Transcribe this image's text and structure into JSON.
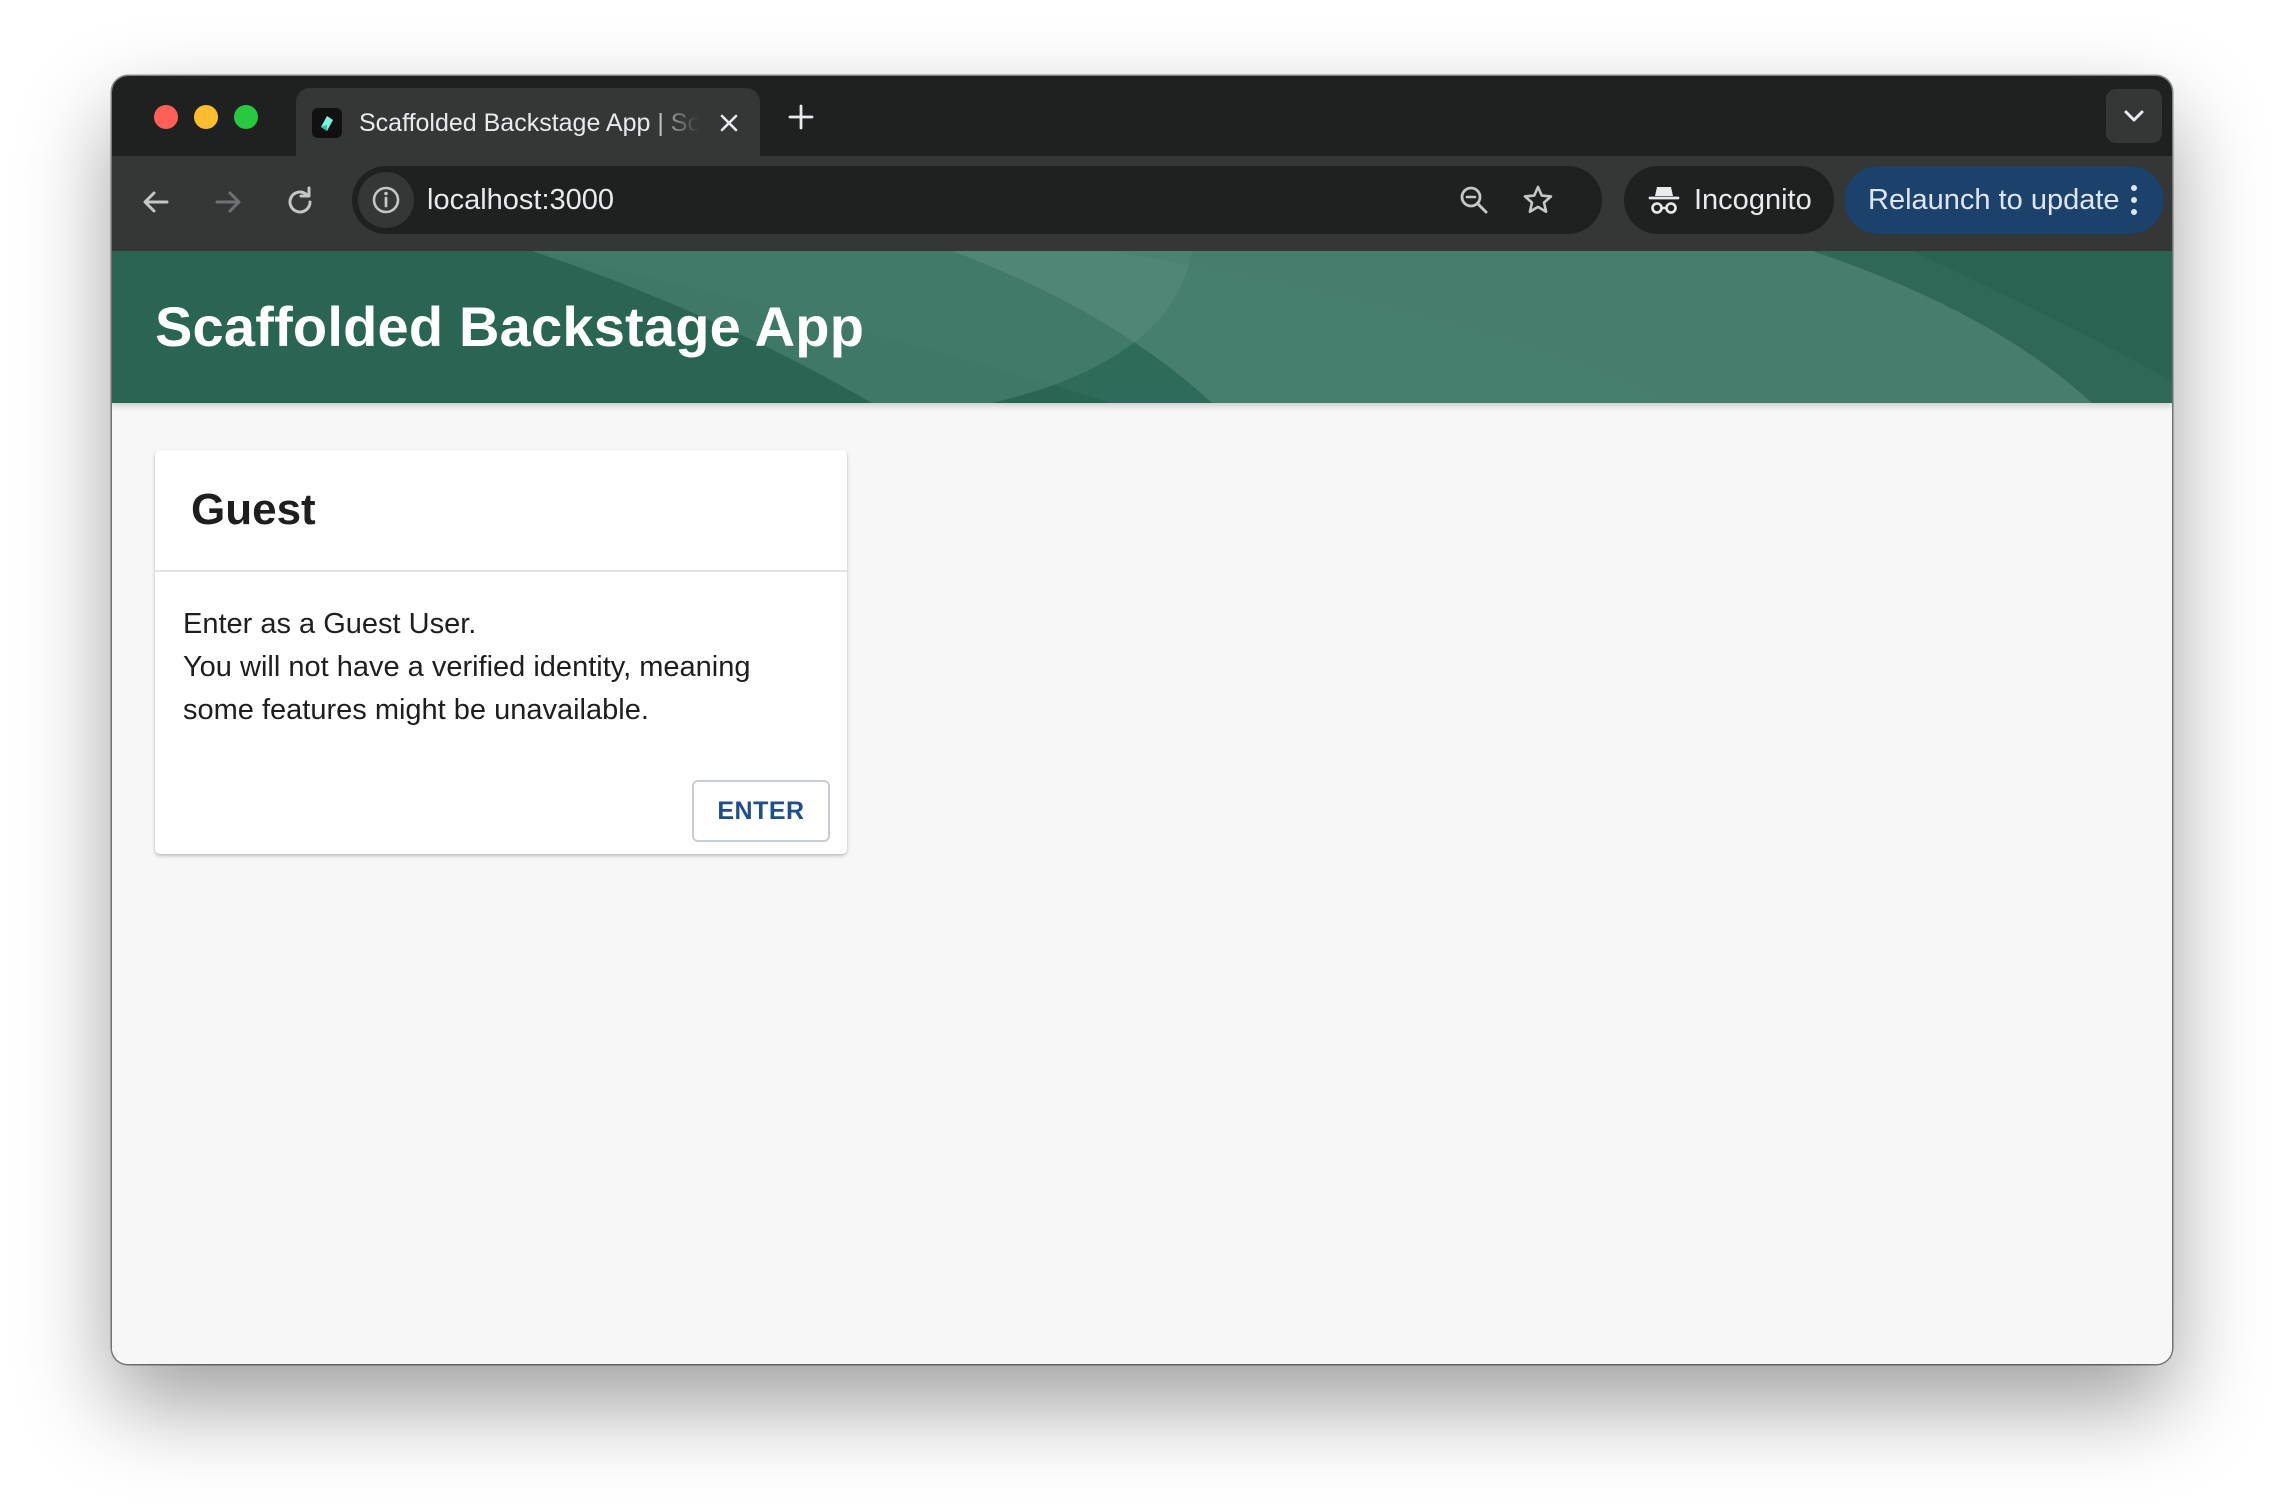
{
  "browser": {
    "tab": {
      "title": "Scaffolded Backstage App | Scaffolded Backstage App"
    },
    "address_bar": {
      "url": "localhost:3000"
    },
    "incognito_label": "Incognito",
    "relaunch_label": "Relaunch to update"
  },
  "app": {
    "title": "Scaffolded Backstage App",
    "header_color": "#2f6b5a"
  },
  "guest_card": {
    "title": "Guest",
    "body_lines": [
      "Enter as a Guest User.",
      "You will not have a verified identity, meaning",
      "some features might be unavailable."
    ],
    "enter_label": "ENTER"
  }
}
